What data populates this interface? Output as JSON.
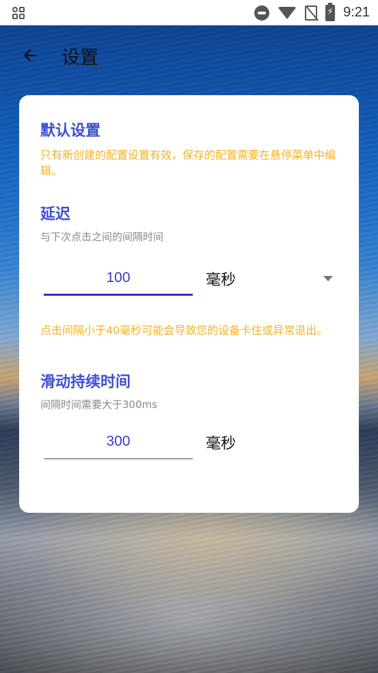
{
  "status_bar": {
    "time": "9:21",
    "icons": [
      "grid-icon",
      "do-not-disturb-icon",
      "wifi-icon",
      "no-sim-icon",
      "battery-charging-icon"
    ]
  },
  "app_bar": {
    "back_icon": "arrow-left-icon",
    "title": "设置"
  },
  "card": {
    "default_settings": {
      "title": "默认设置",
      "note": "只有新创建的配置设置有效，保存的配置需要在悬停菜单中编辑。"
    },
    "delay": {
      "title": "延迟",
      "description": "与下次点击之间的间隔时间",
      "value": "100",
      "unit": "毫秒",
      "warning": "点击间隔小于40毫秒可能会导致您的设备卡住或异常退出。"
    },
    "swipe_duration": {
      "title": "滑动持续时间",
      "description": "间隔时间需要大于300ms",
      "value": "300",
      "unit": "毫秒"
    }
  },
  "colors": {
    "accent": "#3d4fd1",
    "warning": "#f4b321",
    "input_underline_active": "#3030c4"
  }
}
